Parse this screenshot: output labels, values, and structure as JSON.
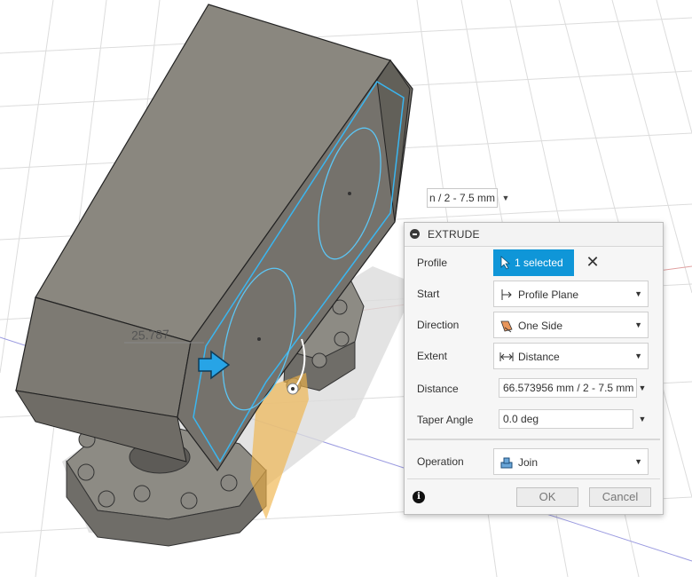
{
  "viewport": {
    "dimension_value": "25.787",
    "floating_input_value": "n / 2 - 7.5 mm"
  },
  "dialog": {
    "title": "EXTRUDE",
    "rows": {
      "profile": {
        "label": "Profile",
        "value": "1 selected"
      },
      "start": {
        "label": "Start",
        "value": "Profile Plane"
      },
      "direction": {
        "label": "Direction",
        "value": "One Side"
      },
      "extent": {
        "label": "Extent",
        "value": "Distance"
      },
      "distance": {
        "label": "Distance",
        "value": "66.573956 mm / 2 - 7.5 mm"
      },
      "taper": {
        "label": "Taper Angle",
        "value": "0.0 deg"
      },
      "operation": {
        "label": "Operation",
        "value": "Join"
      }
    },
    "buttons": {
      "ok": "OK",
      "cancel": "Cancel"
    }
  },
  "colors": {
    "accent": "#0f96d8",
    "body_gray": "#8a877f",
    "preview_orange": "#f0b44a"
  }
}
